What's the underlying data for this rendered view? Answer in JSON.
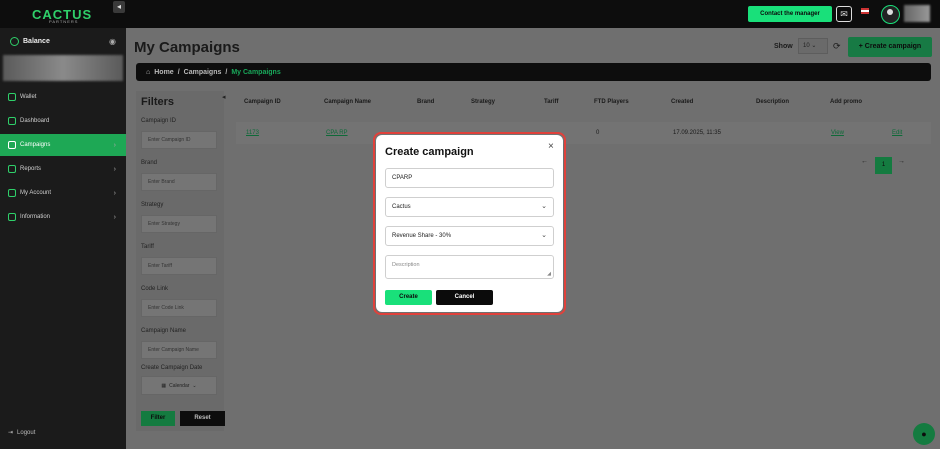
{
  "brand": {
    "name": "CACTUS",
    "sub": "PARTNERS"
  },
  "sidebar": {
    "balance_label": "Balance",
    "items": [
      {
        "label": "Wallet",
        "icon": "wallet-icon"
      },
      {
        "label": "Dashboard",
        "icon": "dashboard-icon"
      },
      {
        "label": "Campaigns",
        "icon": "gear-icon",
        "active": true
      },
      {
        "label": "Reports",
        "icon": "chart-icon"
      },
      {
        "label": "My Account",
        "icon": "user-icon"
      },
      {
        "label": "Information",
        "icon": "info-icon"
      }
    ],
    "logout": "Logout"
  },
  "topbar": {
    "contact_label": "Contact the manager"
  },
  "main": {
    "title": "My Campaigns",
    "show_label": "Show",
    "show_value": "10",
    "create_button": "+ Create campaign",
    "breadcrumb": [
      "Home",
      "/",
      "Campaigns",
      "/",
      "My Campaigns"
    ]
  },
  "filters": {
    "title": "Filters",
    "fields": [
      {
        "label": "Campaign ID",
        "placeholder": "Enter Campaign ID"
      },
      {
        "label": "Brand",
        "placeholder": "Enter Brand"
      },
      {
        "label": "Strategy",
        "placeholder": "Enter Strategy"
      },
      {
        "label": "Tariff",
        "placeholder": "Enter Tariff"
      },
      {
        "label": "Code Link",
        "placeholder": "Enter Code Link"
      },
      {
        "label": "Campaign Name",
        "placeholder": "Enter Campaign Name"
      }
    ],
    "date_label": "Create Campaign Date",
    "calendar": "Calendar",
    "filter_button": "Filter",
    "reset_button": "Reset"
  },
  "table": {
    "headers": [
      "Campaign ID",
      "Campaign Name",
      "Brand",
      "Strategy",
      "Tariff",
      "FTD Players",
      "Created",
      "Description",
      "Add promo"
    ],
    "row": {
      "id": "1173",
      "name": "CPA RP",
      "ftd": "0",
      "created": "17.09.2025, 11:35",
      "view": "View",
      "edit": "Edit"
    }
  },
  "pagination": {
    "current": "1",
    "prev": "←",
    "next": "→"
  },
  "modal": {
    "title": "Create campaign",
    "name_value": "CPARP",
    "brand_value": "Cactus",
    "tariff_value": "Revenue Share - 30%",
    "description_placeholder": "Description",
    "create_button": "Create",
    "cancel_button": "Cancel"
  },
  "colors": {
    "accent": "#19e07a",
    "highlight": "#e0413b"
  }
}
